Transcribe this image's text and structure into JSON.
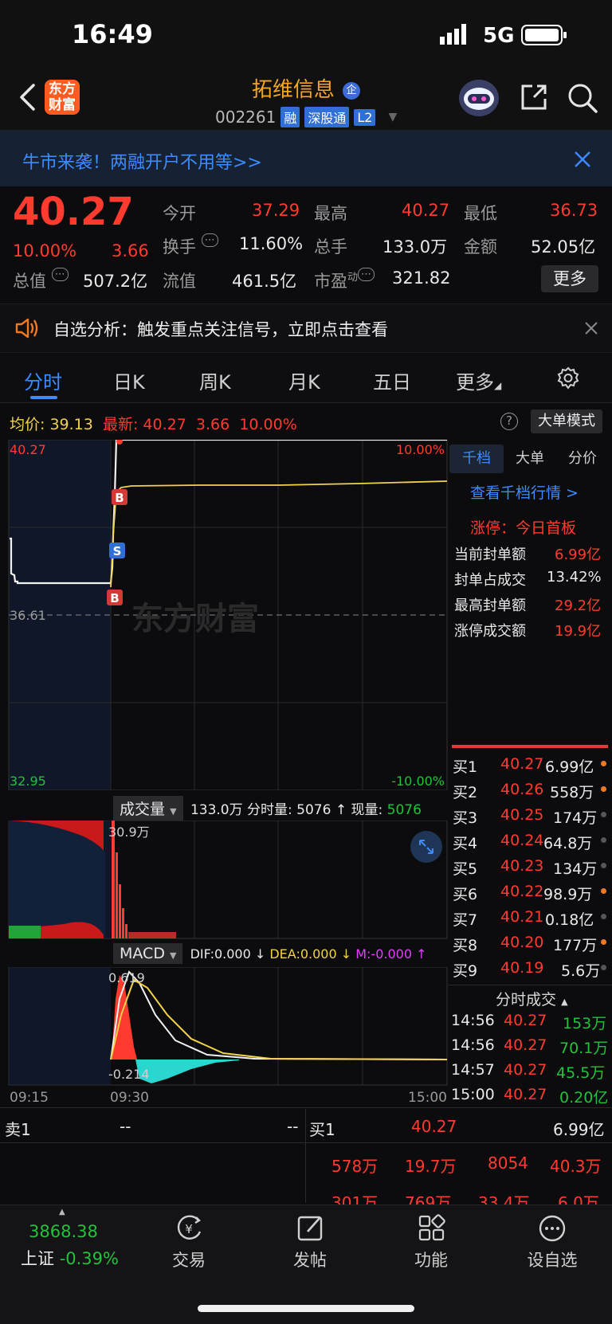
{
  "status": {
    "time": "16:49",
    "network": "5G"
  },
  "header": {
    "logo_line1": "东方",
    "logo_line2": "财富",
    "stock_name": "拓维信息",
    "badge": "企",
    "code": "002261",
    "tags": [
      "融",
      "深股通",
      "L2"
    ]
  },
  "banner": {
    "text": "牛市来袭！两融开户不用等>>"
  },
  "quote": {
    "price": "40.27",
    "change_pct": "10.00%",
    "change": "3.66",
    "open_label": "今开",
    "open": "37.29",
    "high_label": "最高",
    "high": "40.27",
    "low_label": "最低",
    "low": "36.73",
    "turnover_label": "换手",
    "turnover": "11.60%",
    "volume_label": "总手",
    "volume": "133.0万",
    "amount_label": "金额",
    "amount": "52.05亿",
    "mktcap_label": "总值",
    "mktcap": "507.2亿",
    "float_label": "流值",
    "float": "461.5亿",
    "pe_label": "市盈",
    "pe_sup": "动",
    "pe": "321.82",
    "more": "更多"
  },
  "notice": {
    "text": "自选分析：触发重点关注信号，立即点击查看"
  },
  "tabs": [
    "分时",
    "日K",
    "周K",
    "月K",
    "五日",
    "更多"
  ],
  "info_line": {
    "avg_label": "均价:",
    "avg": "39.13",
    "latest_label": "最新:",
    "latest": "40.27",
    "chg": "3.66",
    "pct": "10.00%",
    "help": "?",
    "big_order": "大单模式"
  },
  "chart": {
    "price_top": "40.27",
    "pct_top": "10.00%",
    "price_mid": "36.61",
    "price_bottom": "32.95",
    "pct_bottom": "-10.00%",
    "watermark": "东方财富",
    "markers": [
      "B",
      "S",
      "B"
    ]
  },
  "volume_bar": {
    "label": "成交量",
    "total": "133.0万",
    "slice_label": "分时量:",
    "slice": "5076",
    "now_label": "现量:",
    "now": "5076",
    "max_label": "30.9万"
  },
  "macd_bar": {
    "label": "MACD",
    "dif": "DIF:0.000",
    "dea": "DEA:0.000",
    "m": "M:-0.000",
    "top": "0.619",
    "bottom": "-0.214"
  },
  "time_axis": [
    "09:15",
    "09:30",
    "15:00"
  ],
  "right_panel": {
    "tabs": [
      "千档",
      "大单",
      "分价"
    ],
    "link": "查看千档行情 >",
    "limit_label": "涨停：今日首板",
    "stats": [
      {
        "label": "当前封单额",
        "value": "6.99亿",
        "color": "red"
      },
      {
        "label": "封单占成交",
        "value": "13.42%",
        "color": "white"
      },
      {
        "label": "最高封单额",
        "value": "29.2亿",
        "color": "red"
      },
      {
        "label": "涨停成交额",
        "value": "19.9亿",
        "color": "red"
      }
    ],
    "book": [
      {
        "label": "买1",
        "price": "40.27",
        "vol": "6.99亿"
      },
      {
        "label": "买2",
        "price": "40.26",
        "vol": "558万"
      },
      {
        "label": "买3",
        "price": "40.25",
        "vol": "174万"
      },
      {
        "label": "买4",
        "price": "40.24",
        "vol": "64.8万"
      },
      {
        "label": "买5",
        "price": "40.23",
        "vol": "134万"
      },
      {
        "label": "买6",
        "price": "40.22",
        "vol": "98.9万"
      },
      {
        "label": "买7",
        "price": "40.21",
        "vol": "0.18亿"
      },
      {
        "label": "买8",
        "price": "40.20",
        "vol": "177万"
      },
      {
        "label": "买9",
        "price": "40.19",
        "vol": "5.6万"
      }
    ],
    "ticks_title": "分时成交",
    "ticks": [
      {
        "time": "14:56",
        "price": "40.27",
        "vol": "153万"
      },
      {
        "time": "14:56",
        "price": "40.27",
        "vol": "70.1万"
      },
      {
        "time": "14:57",
        "price": "40.27",
        "vol": "45.5万"
      },
      {
        "time": "15:00",
        "price": "40.27",
        "vol": "0.20亿"
      }
    ]
  },
  "bottom_table": {
    "sell_label": "卖1",
    "sell_a": "--",
    "sell_b": "--",
    "buy_label": "买1",
    "buy_price": "40.27",
    "buy_vol": "6.99亿",
    "row2": [
      "578万",
      "19.7万",
      "8054",
      "40.3万"
    ],
    "row3": [
      "301万",
      "769万",
      "33.4万",
      "6.0万"
    ]
  },
  "tabbar": {
    "index_value": "3868.38",
    "index_name": "上证",
    "index_change": "-0.39%",
    "items": [
      "交易",
      "发帖",
      "功能",
      "设自选"
    ]
  }
}
